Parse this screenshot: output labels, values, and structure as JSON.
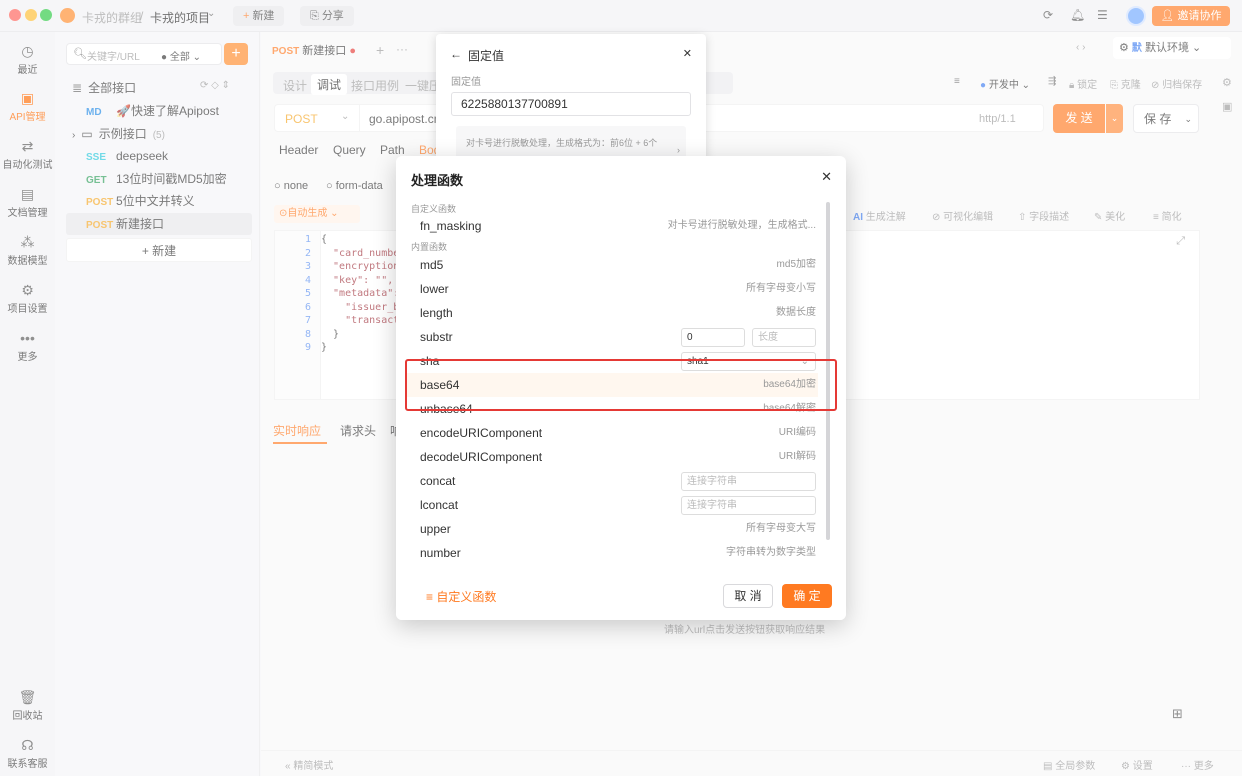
{
  "titlebar": {
    "group": "卡戎的群组",
    "sep": "/",
    "project": "卡戎的项目",
    "new_btn": "新建",
    "share_btn": "分享",
    "invite_btn": "邀请协作"
  },
  "leftnav": [
    {
      "label": "最近",
      "icon": "clock-icon"
    },
    {
      "label": "API管理",
      "icon": "api-icon"
    },
    {
      "label": "自动化测试",
      "icon": "automation-icon"
    },
    {
      "label": "文档管理",
      "icon": "doc-icon"
    },
    {
      "label": "数据模型",
      "icon": "model-icon"
    },
    {
      "label": "项目设置",
      "icon": "settings-icon"
    },
    {
      "label": "更多",
      "icon": "more-icon"
    },
    {
      "label": "回收站",
      "icon": "trash-icon"
    },
    {
      "label": "联系客服",
      "icon": "headset-icon"
    }
  ],
  "tree": {
    "search_placeholder": "关键字/URL",
    "filter": "全部",
    "root": "全部接口",
    "items": [
      {
        "method": "MD",
        "name": "🚀快速了解Apipost",
        "color": "#1e88e5"
      },
      {
        "method": "",
        "name": "示例接口",
        "count": "(5)",
        "folder": true
      },
      {
        "method": "SSE",
        "name": "deepseek",
        "color": "#26c6da"
      },
      {
        "method": "GET",
        "name": "13位时间戳MD5加密",
        "color": "#2e9e5b"
      },
      {
        "method": "POST",
        "name": "5位中文并转义",
        "color": "#f5a623"
      },
      {
        "method": "POST",
        "name": "新建接口",
        "color": "#f5a623"
      }
    ],
    "new_label": "新建"
  },
  "main": {
    "tab_method": "POST",
    "tab_name": "新建接口",
    "subtabs": [
      "设计",
      "调试",
      "接口用例",
      "一键压测"
    ],
    "env": "默认环境",
    "status": "开发中",
    "lock": "锁定",
    "clone": "克隆",
    "archive": "归档保存",
    "method": "POST",
    "url": "go.apipost.cn",
    "protocol": "http/1.1",
    "send": "发 送",
    "save": "保 存",
    "req_tabs": [
      "Header",
      "Query",
      "Path",
      "Body"
    ],
    "body_types": [
      "none",
      "form-data"
    ],
    "auto_gen": "自动生成",
    "tools": [
      "生成注解",
      "可视化编辑",
      "字段描述",
      "美化",
      "简化"
    ],
    "code": [
      "{",
      "  \"card_number",
      "  \"encryption_",
      "  \"key\": \"\",",
      "  \"metadata\":",
      "    \"issuer_ba",
      "    \"transacti",
      "  }",
      "}"
    ],
    "resp_tabs": [
      "实时响应",
      "请求头",
      "响"
    ],
    "resp_hint": "请输入url点击发送按钮获取响应结果",
    "footer_left": "精简模式",
    "footer_right": [
      "全局参数",
      "设置",
      "更多"
    ]
  },
  "popover": {
    "title": "固定值",
    "label": "固定值",
    "value": "6225880137700891",
    "hint": "对卡号进行脱敏处理，生成格式为：前6位 + 6个"
  },
  "dialog": {
    "title": "处理函数",
    "custom_section": "自定义函数",
    "builtin_section": "内置函数",
    "custom_fn": {
      "name": "fn_masking",
      "desc": "对卡号进行脱敏处理，生成格式..."
    },
    "functions": [
      {
        "name": "md5",
        "desc": "md5加密"
      },
      {
        "name": "lower",
        "desc": "所有字母变小写"
      },
      {
        "name": "length",
        "desc": "数据长度"
      },
      {
        "name": "substr",
        "input1": "0",
        "input2_placeholder": "长度"
      },
      {
        "name": "sha",
        "select": "sha1"
      },
      {
        "name": "base64",
        "desc": "base64加密"
      },
      {
        "name": "unbase64",
        "desc": "base64解密"
      },
      {
        "name": "encodeURIComponent",
        "desc": "URI编码"
      },
      {
        "name": "decodeURIComponent",
        "desc": "URI解码"
      },
      {
        "name": "concat",
        "placeholder": "连接字符串"
      },
      {
        "name": "lconcat",
        "placeholder": "连接字符串"
      },
      {
        "name": "upper",
        "desc": "所有字母变大写"
      },
      {
        "name": "number",
        "desc": "字符串转为数字类型"
      }
    ],
    "add_custom": "自定义函数",
    "cancel": "取 消",
    "confirm": "确 定",
    "highlight_color": "#e53935",
    "accent": "#ff7a21"
  }
}
